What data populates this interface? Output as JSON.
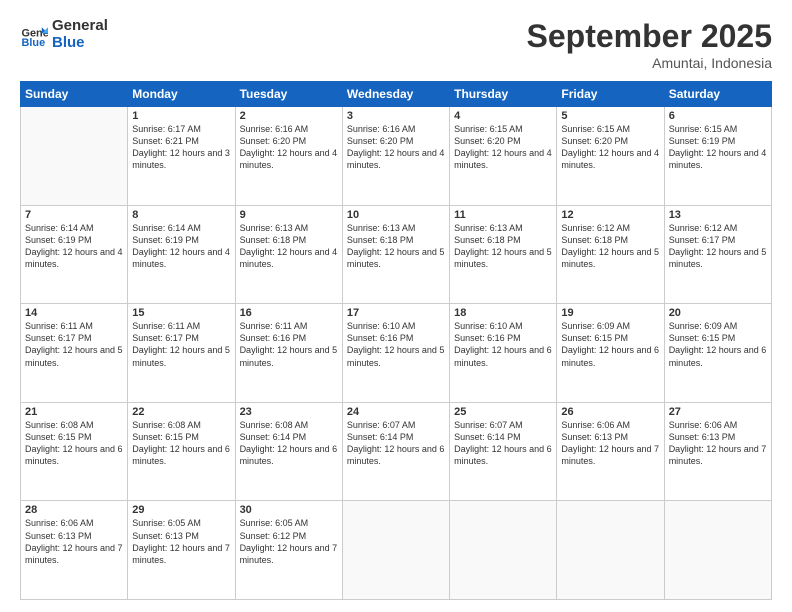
{
  "header": {
    "logo_general": "General",
    "logo_blue": "Blue",
    "month_title": "September 2025",
    "location": "Amuntai, Indonesia"
  },
  "weekdays": [
    "Sunday",
    "Monday",
    "Tuesday",
    "Wednesday",
    "Thursday",
    "Friday",
    "Saturday"
  ],
  "weeks": [
    [
      {
        "day": "",
        "sunrise": "",
        "sunset": "",
        "daylight": ""
      },
      {
        "day": "1",
        "sunrise": "Sunrise: 6:17 AM",
        "sunset": "Sunset: 6:21 PM",
        "daylight": "Daylight: 12 hours and 3 minutes."
      },
      {
        "day": "2",
        "sunrise": "Sunrise: 6:16 AM",
        "sunset": "Sunset: 6:20 PM",
        "daylight": "Daylight: 12 hours and 4 minutes."
      },
      {
        "day": "3",
        "sunrise": "Sunrise: 6:16 AM",
        "sunset": "Sunset: 6:20 PM",
        "daylight": "Daylight: 12 hours and 4 minutes."
      },
      {
        "day": "4",
        "sunrise": "Sunrise: 6:15 AM",
        "sunset": "Sunset: 6:20 PM",
        "daylight": "Daylight: 12 hours and 4 minutes."
      },
      {
        "day": "5",
        "sunrise": "Sunrise: 6:15 AM",
        "sunset": "Sunset: 6:20 PM",
        "daylight": "Daylight: 12 hours and 4 minutes."
      },
      {
        "day": "6",
        "sunrise": "Sunrise: 6:15 AM",
        "sunset": "Sunset: 6:19 PM",
        "daylight": "Daylight: 12 hours and 4 minutes."
      }
    ],
    [
      {
        "day": "7",
        "sunrise": "Sunrise: 6:14 AM",
        "sunset": "Sunset: 6:19 PM",
        "daylight": "Daylight: 12 hours and 4 minutes."
      },
      {
        "day": "8",
        "sunrise": "Sunrise: 6:14 AM",
        "sunset": "Sunset: 6:19 PM",
        "daylight": "Daylight: 12 hours and 4 minutes."
      },
      {
        "day": "9",
        "sunrise": "Sunrise: 6:13 AM",
        "sunset": "Sunset: 6:18 PM",
        "daylight": "Daylight: 12 hours and 4 minutes."
      },
      {
        "day": "10",
        "sunrise": "Sunrise: 6:13 AM",
        "sunset": "Sunset: 6:18 PM",
        "daylight": "Daylight: 12 hours and 5 minutes."
      },
      {
        "day": "11",
        "sunrise": "Sunrise: 6:13 AM",
        "sunset": "Sunset: 6:18 PM",
        "daylight": "Daylight: 12 hours and 5 minutes."
      },
      {
        "day": "12",
        "sunrise": "Sunrise: 6:12 AM",
        "sunset": "Sunset: 6:18 PM",
        "daylight": "Daylight: 12 hours and 5 minutes."
      },
      {
        "day": "13",
        "sunrise": "Sunrise: 6:12 AM",
        "sunset": "Sunset: 6:17 PM",
        "daylight": "Daylight: 12 hours and 5 minutes."
      }
    ],
    [
      {
        "day": "14",
        "sunrise": "Sunrise: 6:11 AM",
        "sunset": "Sunset: 6:17 PM",
        "daylight": "Daylight: 12 hours and 5 minutes."
      },
      {
        "day": "15",
        "sunrise": "Sunrise: 6:11 AM",
        "sunset": "Sunset: 6:17 PM",
        "daylight": "Daylight: 12 hours and 5 minutes."
      },
      {
        "day": "16",
        "sunrise": "Sunrise: 6:11 AM",
        "sunset": "Sunset: 6:16 PM",
        "daylight": "Daylight: 12 hours and 5 minutes."
      },
      {
        "day": "17",
        "sunrise": "Sunrise: 6:10 AM",
        "sunset": "Sunset: 6:16 PM",
        "daylight": "Daylight: 12 hours and 5 minutes."
      },
      {
        "day": "18",
        "sunrise": "Sunrise: 6:10 AM",
        "sunset": "Sunset: 6:16 PM",
        "daylight": "Daylight: 12 hours and 6 minutes."
      },
      {
        "day": "19",
        "sunrise": "Sunrise: 6:09 AM",
        "sunset": "Sunset: 6:15 PM",
        "daylight": "Daylight: 12 hours and 6 minutes."
      },
      {
        "day": "20",
        "sunrise": "Sunrise: 6:09 AM",
        "sunset": "Sunset: 6:15 PM",
        "daylight": "Daylight: 12 hours and 6 minutes."
      }
    ],
    [
      {
        "day": "21",
        "sunrise": "Sunrise: 6:08 AM",
        "sunset": "Sunset: 6:15 PM",
        "daylight": "Daylight: 12 hours and 6 minutes."
      },
      {
        "day": "22",
        "sunrise": "Sunrise: 6:08 AM",
        "sunset": "Sunset: 6:15 PM",
        "daylight": "Daylight: 12 hours and 6 minutes."
      },
      {
        "day": "23",
        "sunrise": "Sunrise: 6:08 AM",
        "sunset": "Sunset: 6:14 PM",
        "daylight": "Daylight: 12 hours and 6 minutes."
      },
      {
        "day": "24",
        "sunrise": "Sunrise: 6:07 AM",
        "sunset": "Sunset: 6:14 PM",
        "daylight": "Daylight: 12 hours and 6 minutes."
      },
      {
        "day": "25",
        "sunrise": "Sunrise: 6:07 AM",
        "sunset": "Sunset: 6:14 PM",
        "daylight": "Daylight: 12 hours and 6 minutes."
      },
      {
        "day": "26",
        "sunrise": "Sunrise: 6:06 AM",
        "sunset": "Sunset: 6:13 PM",
        "daylight": "Daylight: 12 hours and 7 minutes."
      },
      {
        "day": "27",
        "sunrise": "Sunrise: 6:06 AM",
        "sunset": "Sunset: 6:13 PM",
        "daylight": "Daylight: 12 hours and 7 minutes."
      }
    ],
    [
      {
        "day": "28",
        "sunrise": "Sunrise: 6:06 AM",
        "sunset": "Sunset: 6:13 PM",
        "daylight": "Daylight: 12 hours and 7 minutes."
      },
      {
        "day": "29",
        "sunrise": "Sunrise: 6:05 AM",
        "sunset": "Sunset: 6:13 PM",
        "daylight": "Daylight: 12 hours and 7 minutes."
      },
      {
        "day": "30",
        "sunrise": "Sunrise: 6:05 AM",
        "sunset": "Sunset: 6:12 PM",
        "daylight": "Daylight: 12 hours and 7 minutes."
      },
      {
        "day": "",
        "sunrise": "",
        "sunset": "",
        "daylight": ""
      },
      {
        "day": "",
        "sunrise": "",
        "sunset": "",
        "daylight": ""
      },
      {
        "day": "",
        "sunrise": "",
        "sunset": "",
        "daylight": ""
      },
      {
        "day": "",
        "sunrise": "",
        "sunset": "",
        "daylight": ""
      }
    ]
  ]
}
